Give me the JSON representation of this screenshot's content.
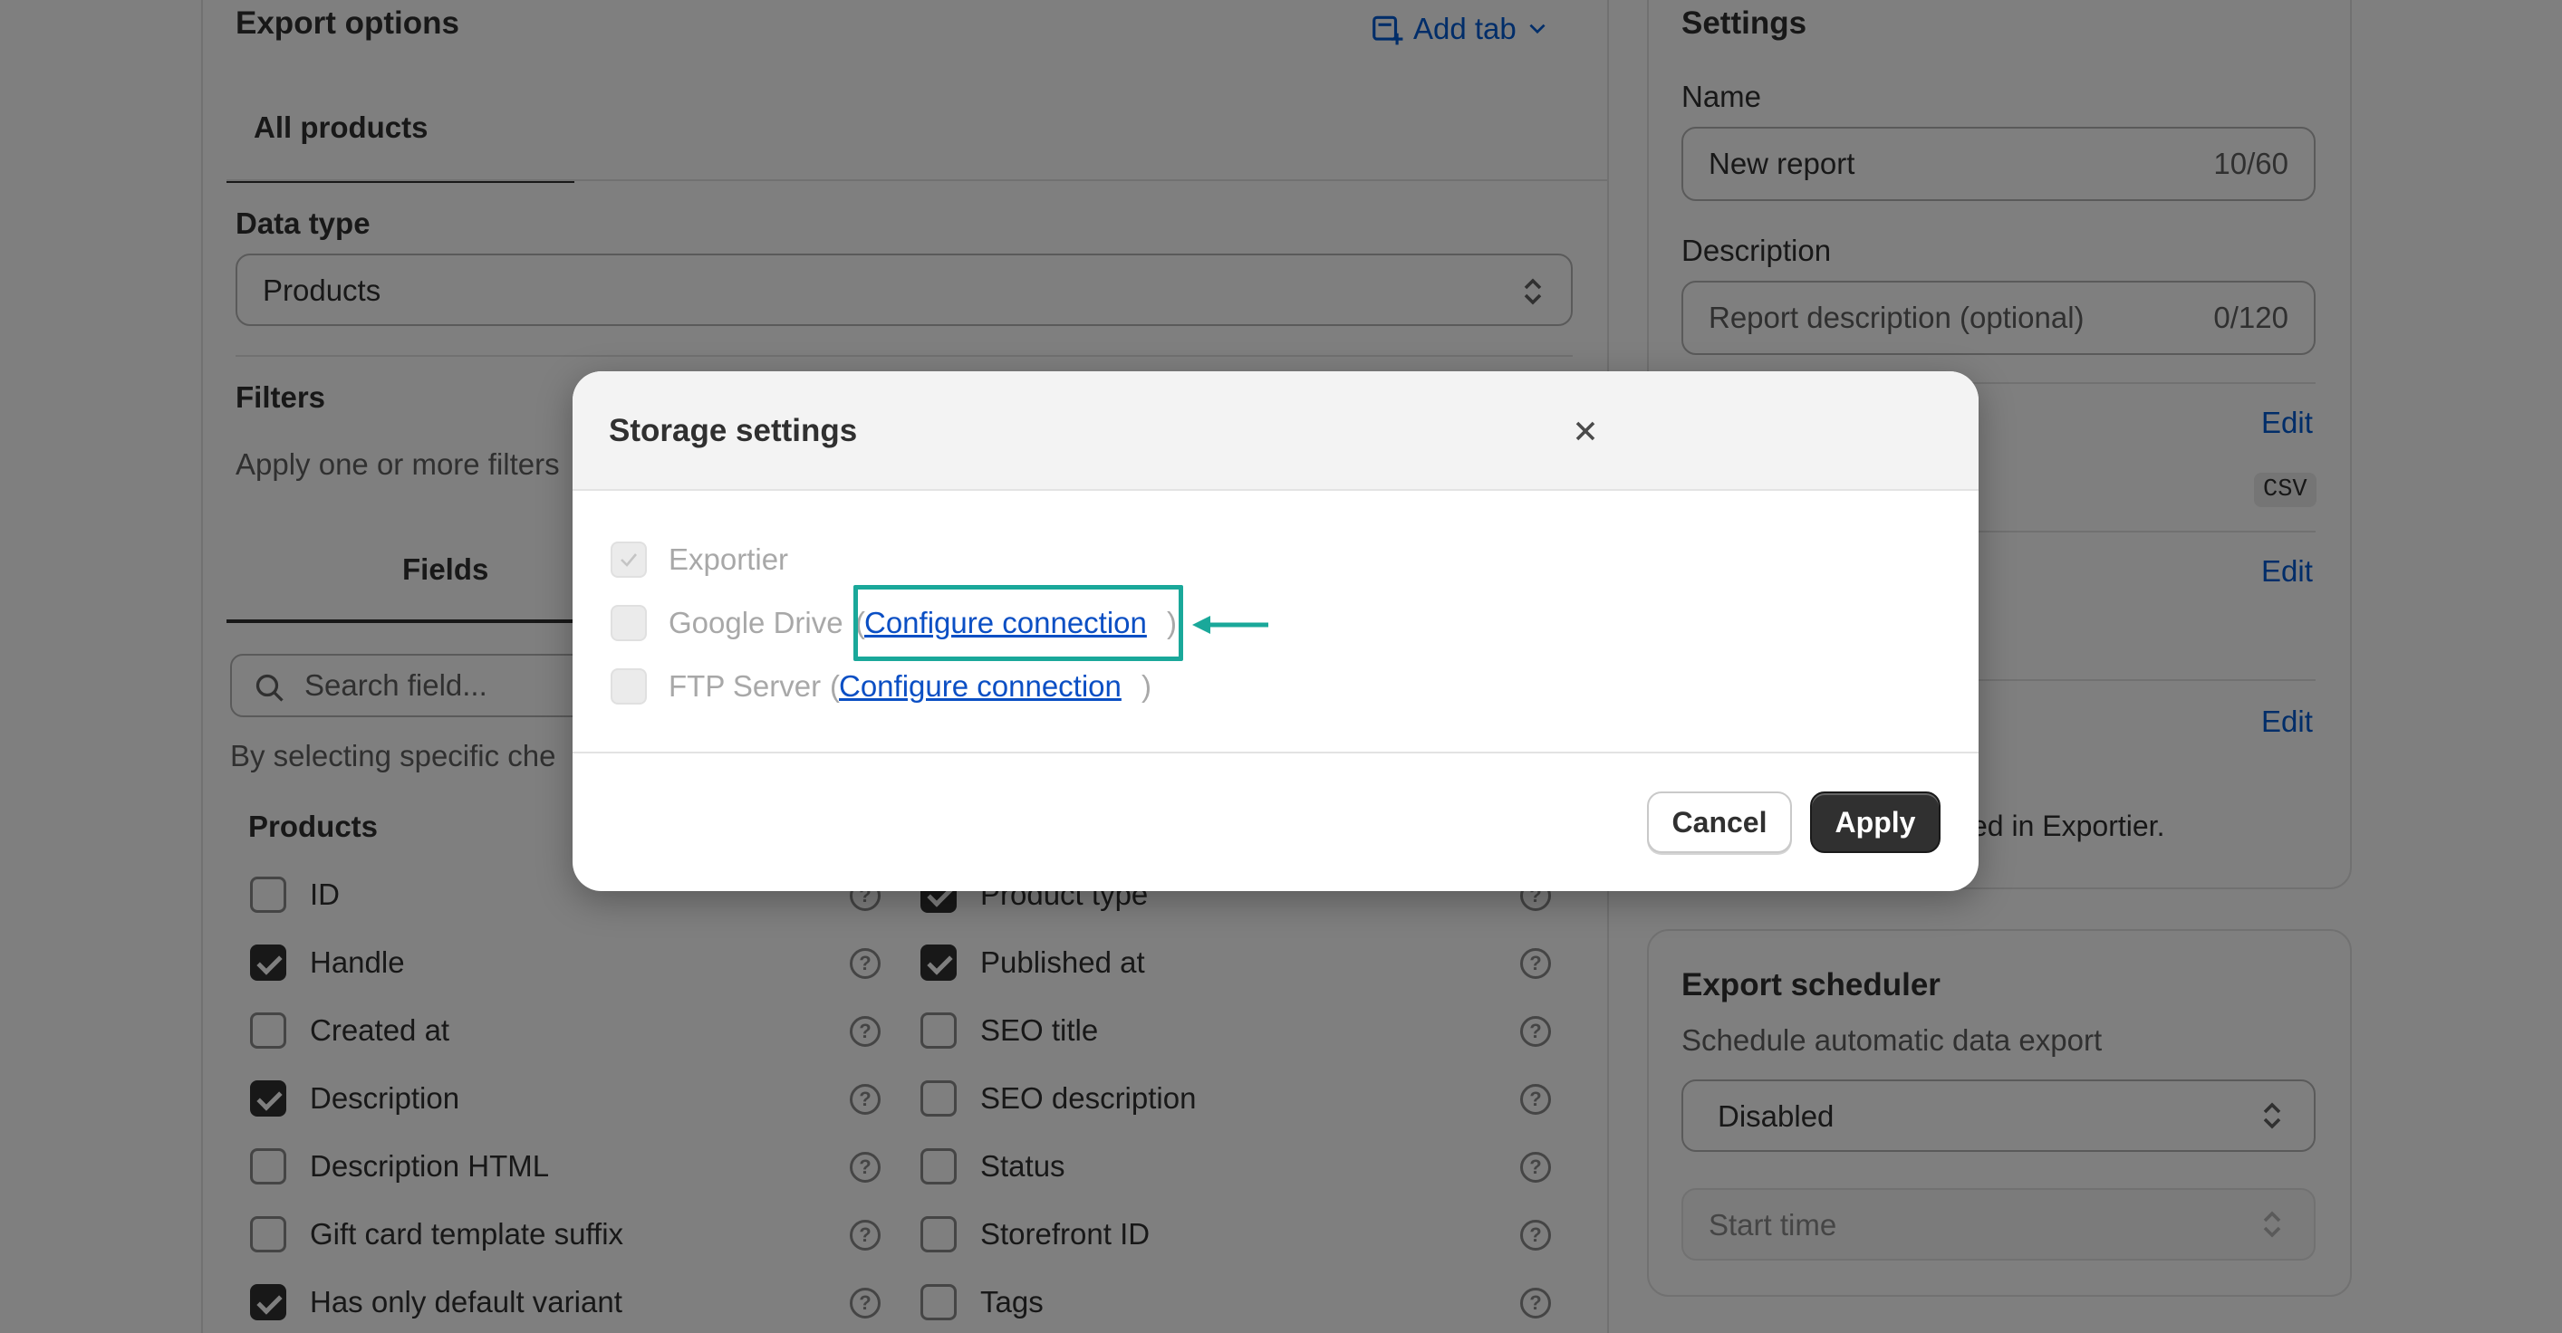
{
  "left_panel": {
    "title": "Export options",
    "add_tab_label": "Add tab",
    "tab_all_products": "All products",
    "data_type_label": "Data type",
    "data_type_value": "Products",
    "filters_title": "Filters",
    "filters_help": "Apply one or more filters",
    "fields_tab": "Fields",
    "search_placeholder": "Search field...",
    "selecting_text": "By selecting specific che",
    "products_heading": "Products",
    "fields_left": [
      {
        "label": "ID",
        "checked": false
      },
      {
        "label": "Handle",
        "checked": true
      },
      {
        "label": "Created at",
        "checked": false
      },
      {
        "label": "Description",
        "checked": true
      },
      {
        "label": "Description HTML",
        "checked": false
      },
      {
        "label": "Gift card template suffix",
        "checked": false
      },
      {
        "label": "Has only default variant",
        "checked": true
      }
    ],
    "fields_right": [
      {
        "label": "Product type",
        "checked": true
      },
      {
        "label": "Published at",
        "checked": true
      },
      {
        "label": "SEO title",
        "checked": false
      },
      {
        "label": "SEO description",
        "checked": false
      },
      {
        "label": "Status",
        "checked": false
      },
      {
        "label": "Storefront ID",
        "checked": false
      },
      {
        "label": "Tags",
        "checked": false
      }
    ]
  },
  "settings": {
    "title": "Settings",
    "name_label": "Name",
    "name_value": "New report",
    "name_count": "10/60",
    "description_label": "Description",
    "description_placeholder": "Report description (optional)",
    "description_count": "0/120",
    "edit_label": "Edit",
    "format_badge": "CSV",
    "storage_note": "ed in Exportier."
  },
  "scheduler": {
    "title": "Export scheduler",
    "subtitle": "Schedule automatic data export",
    "schedule_value": "Disabled",
    "start_time_placeholder": "Start time"
  },
  "modal": {
    "title": "Storage settings",
    "options": [
      {
        "label": "Exportier",
        "link": ""
      },
      {
        "label": "Google Drive",
        "link": "Configure connection"
      },
      {
        "label": "FTP Server",
        "link": "Configure connection"
      }
    ],
    "cancel_label": "Cancel",
    "apply_label": "Apply"
  },
  "annotation": {
    "highlight_color": "#1aa89a"
  }
}
